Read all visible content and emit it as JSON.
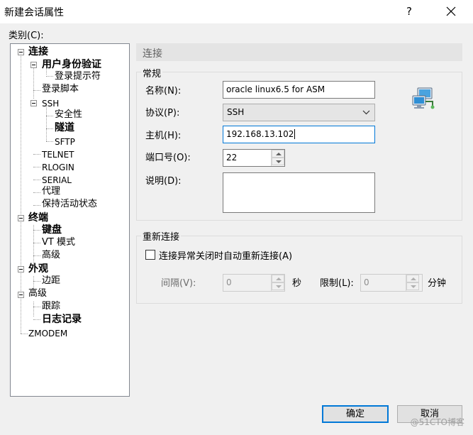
{
  "window": {
    "title": "新建会话属性",
    "help": "?",
    "close": "✕"
  },
  "category": {
    "label": "类别(C):",
    "tree": [
      {
        "label": "连接"
      },
      {
        "label": "用户身份验证"
      },
      {
        "label": "登录提示符"
      },
      {
        "label": "登录脚本"
      },
      {
        "label": "SSH"
      },
      {
        "label": "安全性"
      },
      {
        "label": "隧道"
      },
      {
        "label": "SFTP"
      },
      {
        "label": "TELNET"
      },
      {
        "label": "RLOGIN"
      },
      {
        "label": "SERIAL"
      },
      {
        "label": "代理"
      },
      {
        "label": "保持活动状态"
      },
      {
        "label": "终端"
      },
      {
        "label": "键盘"
      },
      {
        "label": "VT 模式"
      },
      {
        "label": "高级"
      },
      {
        "label": "外观"
      },
      {
        "label": "边距"
      },
      {
        "label": "高级"
      },
      {
        "label": "跟踪"
      },
      {
        "label": "日志记录"
      },
      {
        "label": "ZMODEM"
      }
    ]
  },
  "panel": {
    "title": "连接",
    "general": {
      "title": "常规",
      "name_label": "名称(N):",
      "name_value": "oracle linux6.5 for ASM",
      "protocol_label": "协议(P):",
      "protocol_value": "SSH",
      "host_label": "主机(H):",
      "host_value": "192.168.13.102",
      "port_label": "端口号(O):",
      "port_value": "22",
      "desc_label": "说明(D):",
      "desc_value": ""
    },
    "reconnect": {
      "title": "重新连接",
      "checkbox_label": "连接异常关闭时自动重新连接(A)",
      "checked": false,
      "interval_label": "间隔(V):",
      "interval_value": "0",
      "interval_unit": "秒",
      "limit_label": "限制(L):",
      "limit_value": "0",
      "limit_unit": "分钟"
    }
  },
  "buttons": {
    "ok": "确定",
    "cancel": "取消"
  },
  "watermark": "@51CTO博客",
  "colors": {
    "accent": "#0078d7",
    "panel_bg": "#f0f0f0"
  }
}
